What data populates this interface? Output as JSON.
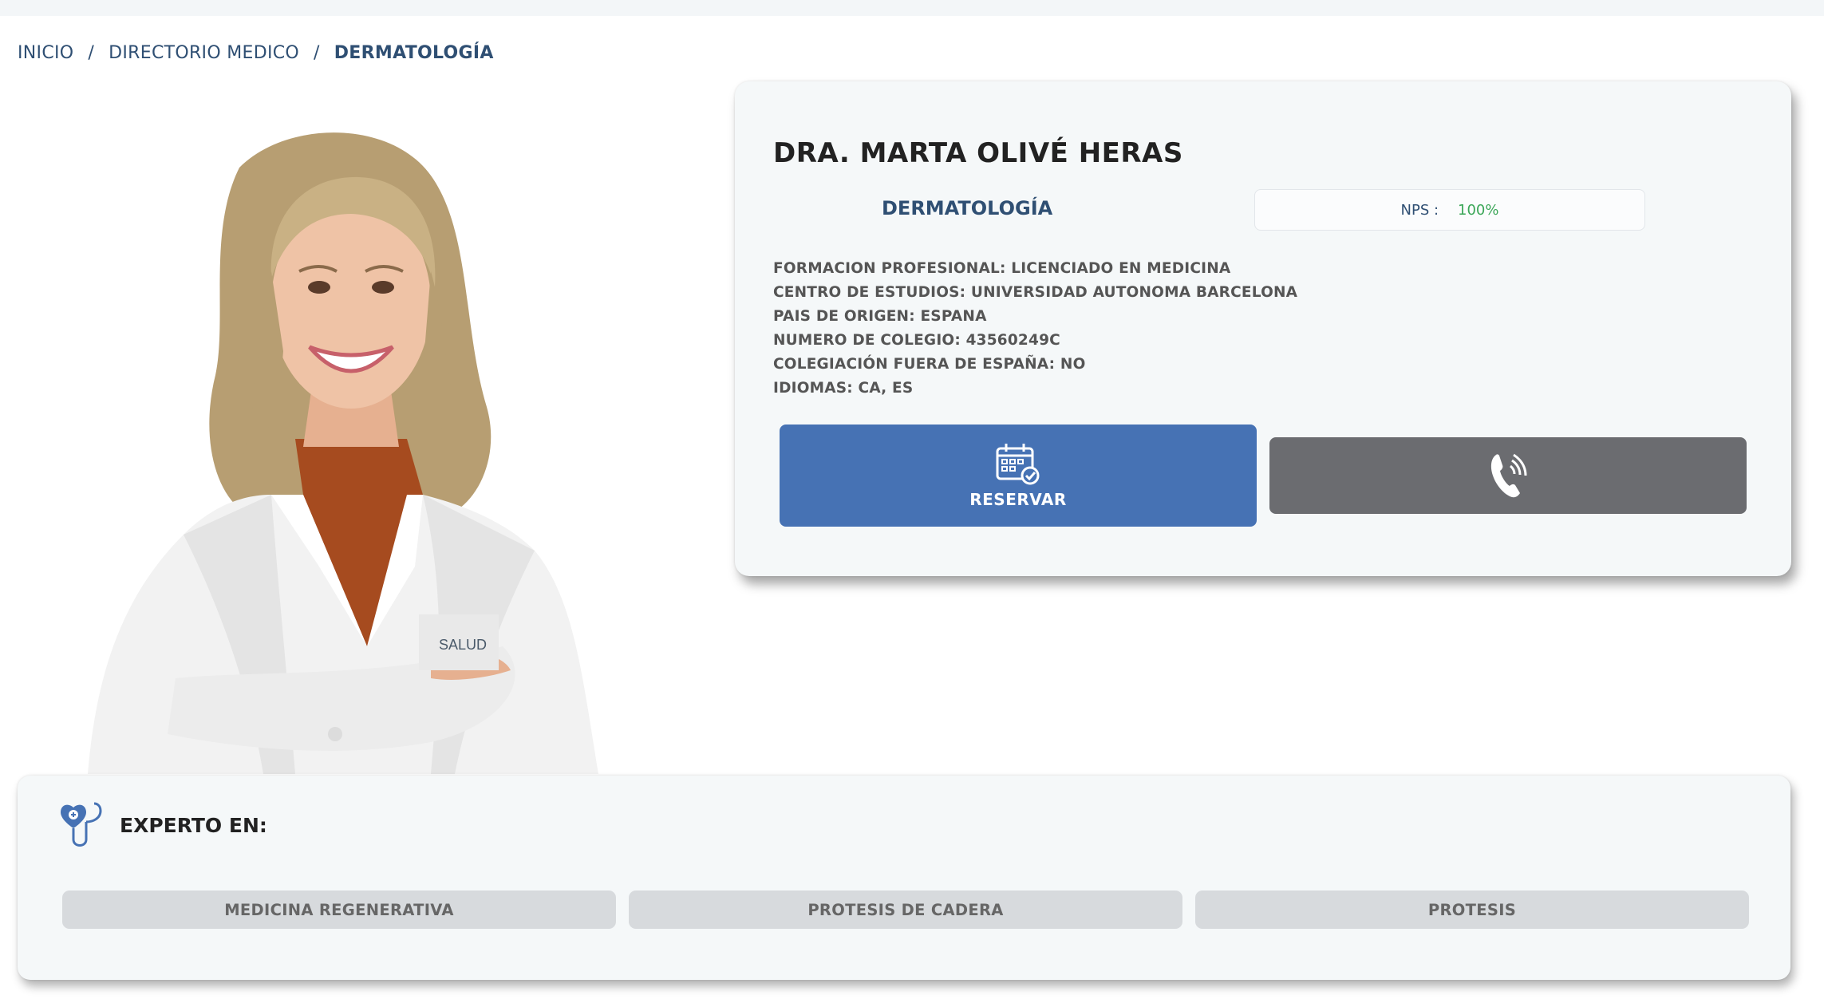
{
  "breadcrumb": {
    "items": [
      "INICIO",
      "DIRECTORIO MEDICO",
      "DERMATOLOGÍA"
    ],
    "separator": "/"
  },
  "doctor": {
    "name": "DRA. MARTA OLIVÉ HERAS",
    "specialty": "DERMATOLOGÍA",
    "nps_label": "NPS :",
    "nps_value": "100%",
    "info": [
      "FORMACION PROFESIONAL: LICENCIADO EN MEDICINA",
      "CENTRO DE ESTUDIOS: UNIVERSIDAD AUTONOMA BARCELONA",
      "PAIS DE ORIGEN: ESPANA",
      "NUMERO DE COLEGIO: 43560249C",
      "COLEGIACIÓN FUERA DE ESPAÑA: NO",
      "IDIOMAS: CA, ES"
    ],
    "photo_logo_text": "SALUD"
  },
  "actions": {
    "reserve_label": "RESERVAR",
    "reserve_icon": "calendar-check-icon",
    "call_icon": "phone-icon"
  },
  "expert": {
    "title": "EXPERTO EN:",
    "icon": "stethoscope-heart-icon",
    "tags": [
      "MEDICINA REGENERATIVA",
      "PROTESIS DE CADERA",
      "PROTESIS"
    ]
  },
  "colors": {
    "primary": "#4672b4",
    "navy_text": "#2f4f73",
    "nps_green": "#3aa657",
    "call_gray": "#6b6c70",
    "tag_gray": "#d7dadd"
  }
}
